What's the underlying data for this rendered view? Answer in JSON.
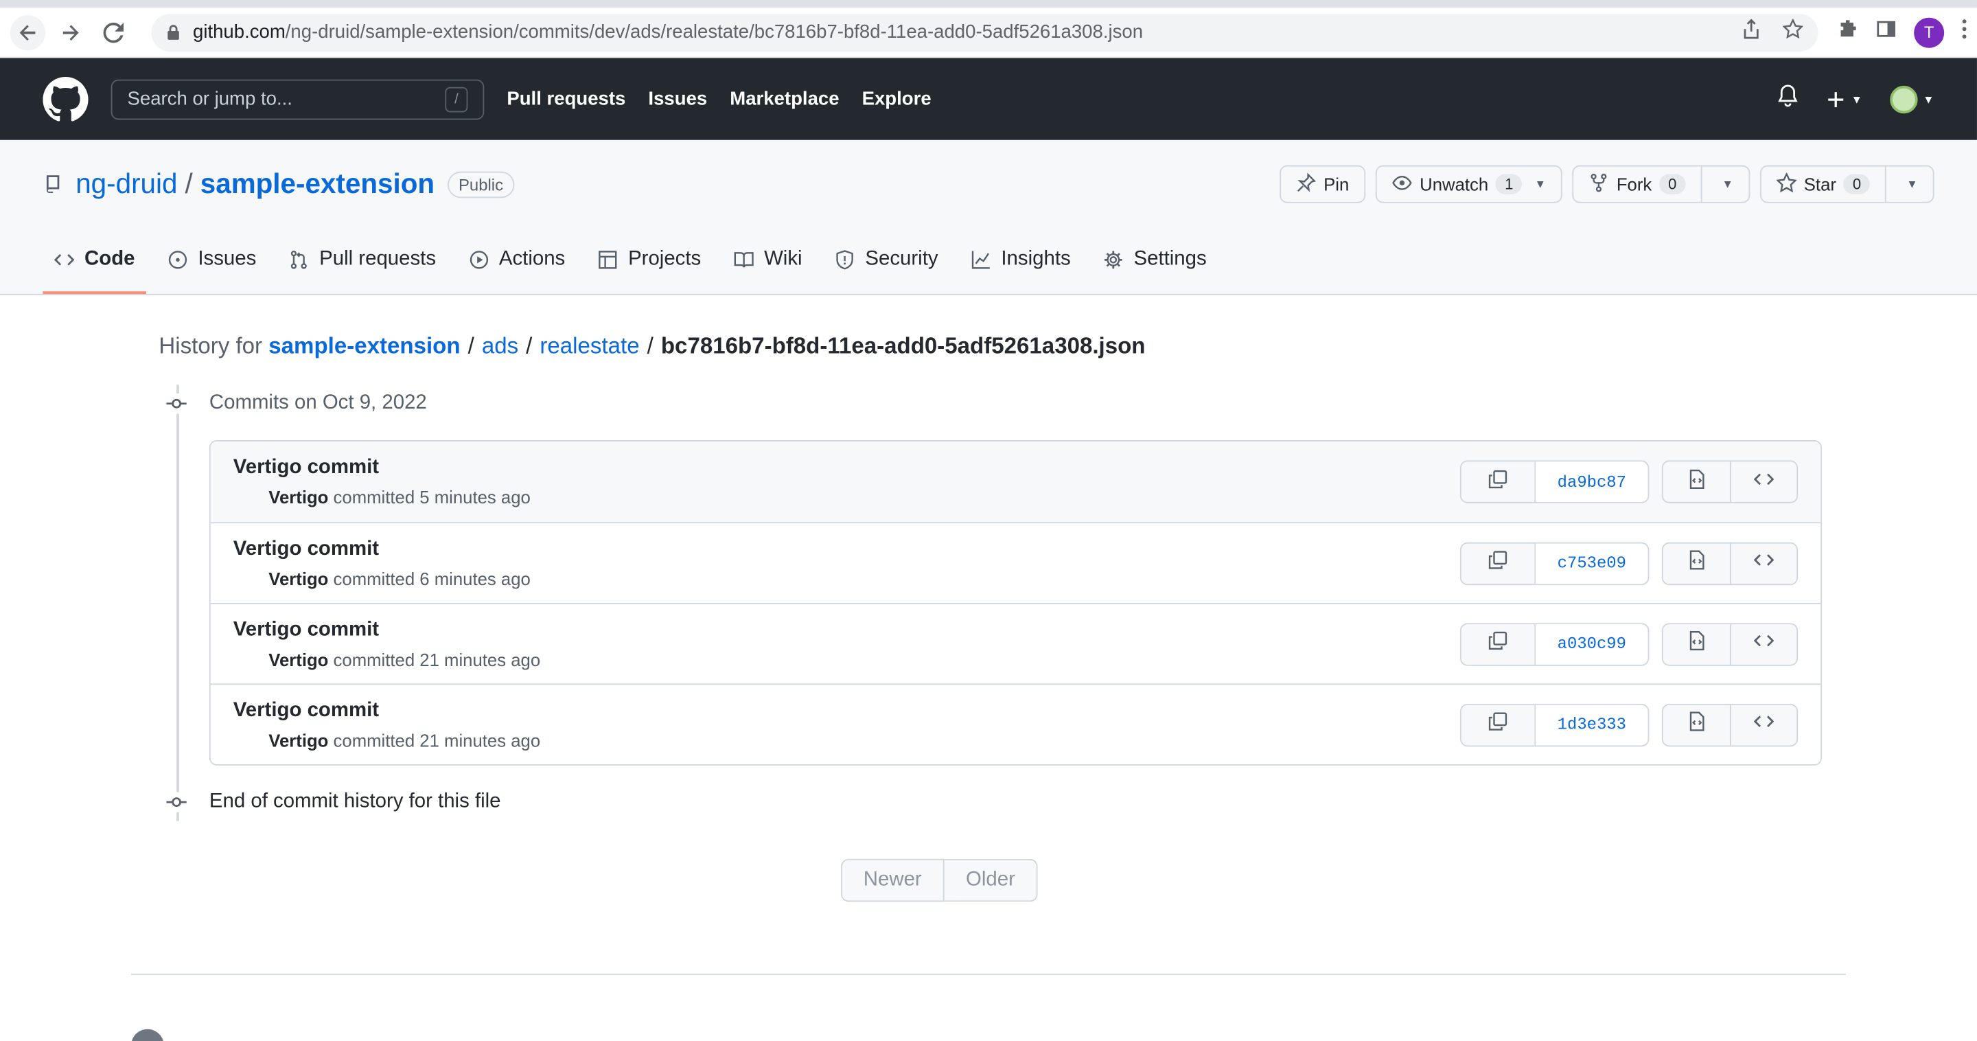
{
  "browser": {
    "url_host": "github.com",
    "url_path": "/ng-druid/sample-extension/commits/dev/ads/realestate/bc7816b7-bf8d-11ea-add0-5adf5261a308.json",
    "profile_initial": "T"
  },
  "header": {
    "search_placeholder": "Search or jump to...",
    "search_shortcut": "/",
    "nav": [
      "Pull requests",
      "Issues",
      "Marketplace",
      "Explore"
    ]
  },
  "repo": {
    "owner": "ng-druid",
    "name": "sample-extension",
    "visibility": "Public",
    "actions": {
      "pin": "Pin",
      "watch": "Unwatch",
      "watch_count": "1",
      "fork": "Fork",
      "fork_count": "0",
      "star": "Star",
      "star_count": "0"
    },
    "tabs": [
      "Code",
      "Issues",
      "Pull requests",
      "Actions",
      "Projects",
      "Wiki",
      "Security",
      "Insights",
      "Settings"
    ]
  },
  "history": {
    "prefix": "History for",
    "crumbs": [
      "sample-extension",
      "ads",
      "realestate"
    ],
    "file": "bc7816b7-bf8d-11ea-add0-5adf5261a308.json",
    "group_label": "Commits on Oct 9, 2022",
    "end_label": "End of commit history for this file",
    "commits": [
      {
        "title": "Vertigo commit",
        "author": "Vertigo",
        "verb": "committed",
        "time": "5 minutes ago",
        "sha": "da9bc87"
      },
      {
        "title": "Vertigo commit",
        "author": "Vertigo",
        "verb": "committed",
        "time": "6 minutes ago",
        "sha": "c753e09"
      },
      {
        "title": "Vertigo commit",
        "author": "Vertigo",
        "verb": "committed",
        "time": "21 minutes ago",
        "sha": "a030c99"
      },
      {
        "title": "Vertigo commit",
        "author": "Vertigo",
        "verb": "committed",
        "time": "21 minutes ago",
        "sha": "1d3e333"
      }
    ],
    "pager": {
      "newer": "Newer",
      "older": "Older"
    }
  },
  "colors": {
    "header_bg": "#24292f",
    "link": "#0969da",
    "tab_underline": "#fd8c73"
  }
}
